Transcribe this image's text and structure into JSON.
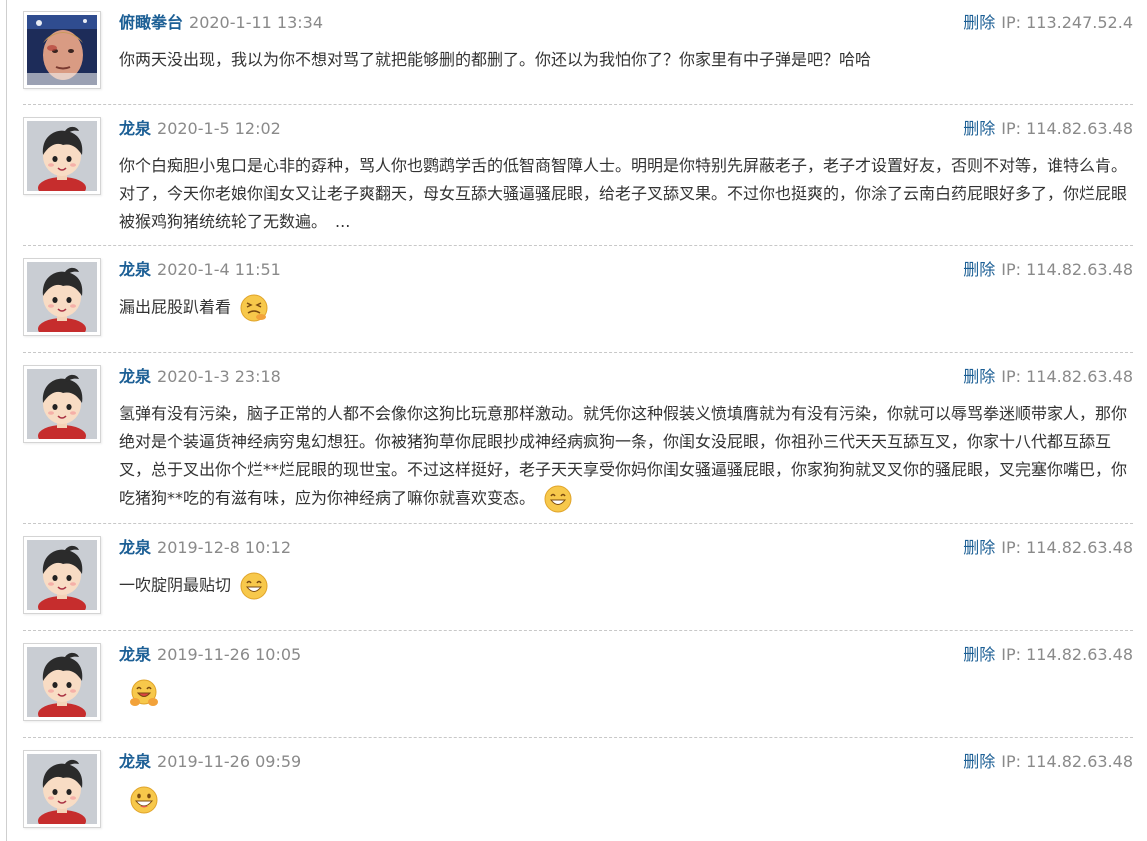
{
  "comments": [
    {
      "user": "俯瞰拳台",
      "time": "2020-1-11 13:34",
      "delete_label": "删除",
      "ip_label": "IP:",
      "ip": "113.247.52.4",
      "avatar": "boxer-photo-avatar",
      "text": "你两天没出现，我以为你不想对骂了就把能够删的都删了。你还以为我怕你了？你家里有中子弹是吧？哈哈"
    },
    {
      "user": "龙泉",
      "time": "2020-1-5 12:02",
      "delete_label": "删除",
      "ip_label": "IP:",
      "ip": "114.82.63.48",
      "avatar": "cartoon-boy-avatar",
      "text": "你个白痴胆小鬼口是心非的孬种，骂人你也鹦鹉学舌的低智商智障人士。明明是你特别先屏蔽老子，老子才设置好友，否则不对等，谁特么肯。对了，今天你老娘你闺女又让老子爽翻天，母女互舔大骚逼骚屁眼，给老子叉舔叉果。不过你也挺爽的，你涂了云南白药屁眼好多了，你烂屁眼被猴鸡狗猪统统轮了无数遍。",
      "ellipsis": "..."
    },
    {
      "user": "龙泉",
      "time": "2020-1-4 11:51",
      "delete_label": "删除",
      "ip_label": "IP:",
      "ip": "114.82.63.48",
      "avatar": "cartoon-boy-avatar",
      "text": "漏出屁股趴着看",
      "emoji": "grimace-emoji"
    },
    {
      "user": "龙泉",
      "time": "2020-1-3 23:18",
      "delete_label": "删除",
      "ip_label": "IP:",
      "ip": "114.82.63.48",
      "avatar": "cartoon-boy-avatar",
      "text": "氢弹有没有污染，脑子正常的人都不会像你这狗比玩意那样激动。就凭你这种假装义愤填膺就为有没有污染，你就可以辱骂拳迷顺带家人，那你绝对是个装逼货神经病穷鬼幻想狂。你被猪狗草你屁眼抄成神经病疯狗一条，你闺女没屁眼，你祖孙三代天天互舔互叉，你家十八代都互舔互叉，总于叉出你个烂**烂屁眼的现世宝。不过这样挺好，老子天天享受你妈你闺女骚逼骚屁眼，你家狗狗就叉叉你的骚屁眼，叉完塞你嘴巴，你吃猪狗**吃的有滋有味，应为你神经病了嘛你就喜欢变态。",
      "emoji": "grin-emoji"
    },
    {
      "user": "龙泉",
      "time": "2019-12-8 10:12",
      "delete_label": "删除",
      "ip_label": "IP:",
      "ip": "114.82.63.48",
      "avatar": "cartoon-boy-avatar",
      "text": "一吹腚阴最贴切",
      "emoji": "grin-emoji"
    },
    {
      "user": "龙泉",
      "time": "2019-11-26 10:05",
      "delete_label": "删除",
      "ip_label": "IP:",
      "ip": "114.82.63.48",
      "avatar": "cartoon-boy-avatar",
      "text": "",
      "emoji": "hug-emoji"
    },
    {
      "user": "龙泉",
      "time": "2019-11-26 09:59",
      "delete_label": "删除",
      "ip_label": "IP:",
      "ip": "114.82.63.48",
      "avatar": "cartoon-boy-avatar",
      "text": "",
      "emoji": "laugh-emoji"
    }
  ]
}
